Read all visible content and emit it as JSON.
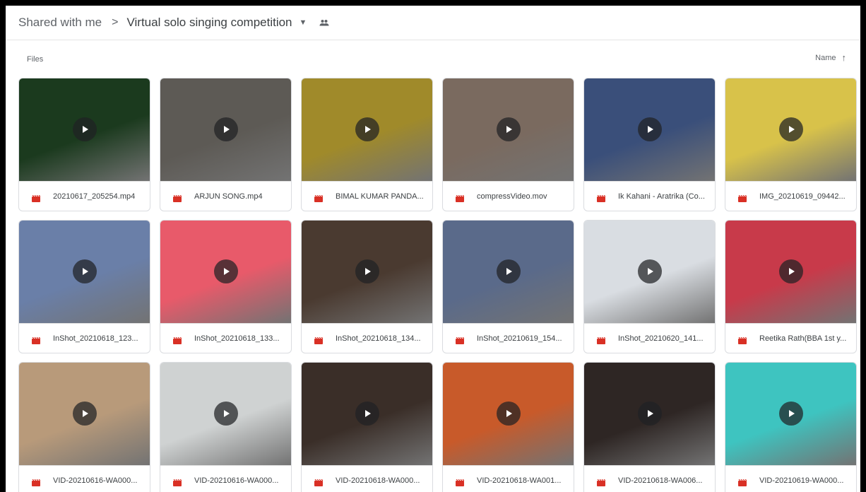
{
  "breadcrumb": {
    "root": "Shared with me",
    "separator": ">",
    "current": "Virtual solo singing competition",
    "dropdown_icon": "caret-down-icon",
    "shared_icon": "people-icon"
  },
  "section": {
    "label": "Files"
  },
  "sort": {
    "label": "Name",
    "direction_icon": "arrow-up-icon"
  },
  "colors": {
    "video_icon": "#d93025",
    "play_overlay": "#202124"
  },
  "files": [
    {
      "name": "20210617_205254.mp4",
      "thumb": "#1b3a1e"
    },
    {
      "name": "ARJUN SONG.mp4",
      "thumb": "#5d5a55"
    },
    {
      "name": "BIMAL KUMAR PANDA...",
      "thumb": "#a08a2a"
    },
    {
      "name": "compressVideo.mov",
      "thumb": "#7a6a5f"
    },
    {
      "name": "Ik Kahani - Aratrika (Co...",
      "thumb": "#3a4f7a"
    },
    {
      "name": "IMG_20210619_09442...",
      "thumb": "#d8c24a"
    },
    {
      "name": "InShot_20210618_123...",
      "thumb": "#6a7fa8"
    },
    {
      "name": "InShot_20210618_133...",
      "thumb": "#e85a6a"
    },
    {
      "name": "InShot_20210618_134...",
      "thumb": "#4a3a30"
    },
    {
      "name": "InShot_20210619_154...",
      "thumb": "#5a6a8a"
    },
    {
      "name": "InShot_20210620_141...",
      "thumb": "#d9dde2"
    },
    {
      "name": "Reetika Rath(BBA 1st y...",
      "thumb": "#c83a4a"
    },
    {
      "name": "VID-20210616-WA000...",
      "thumb": "#b89a7a"
    },
    {
      "name": "VID-20210616-WA000...",
      "thumb": "#cfd2d2"
    },
    {
      "name": "VID-20210618-WA000...",
      "thumb": "#3a2e28"
    },
    {
      "name": "VID-20210618-WA001...",
      "thumb": "#c85a2a"
    },
    {
      "name": "VID-20210618-WA006...",
      "thumb": "#2e2624"
    },
    {
      "name": "VID-20210619-WA000...",
      "thumb": "#3ec4c0"
    }
  ]
}
